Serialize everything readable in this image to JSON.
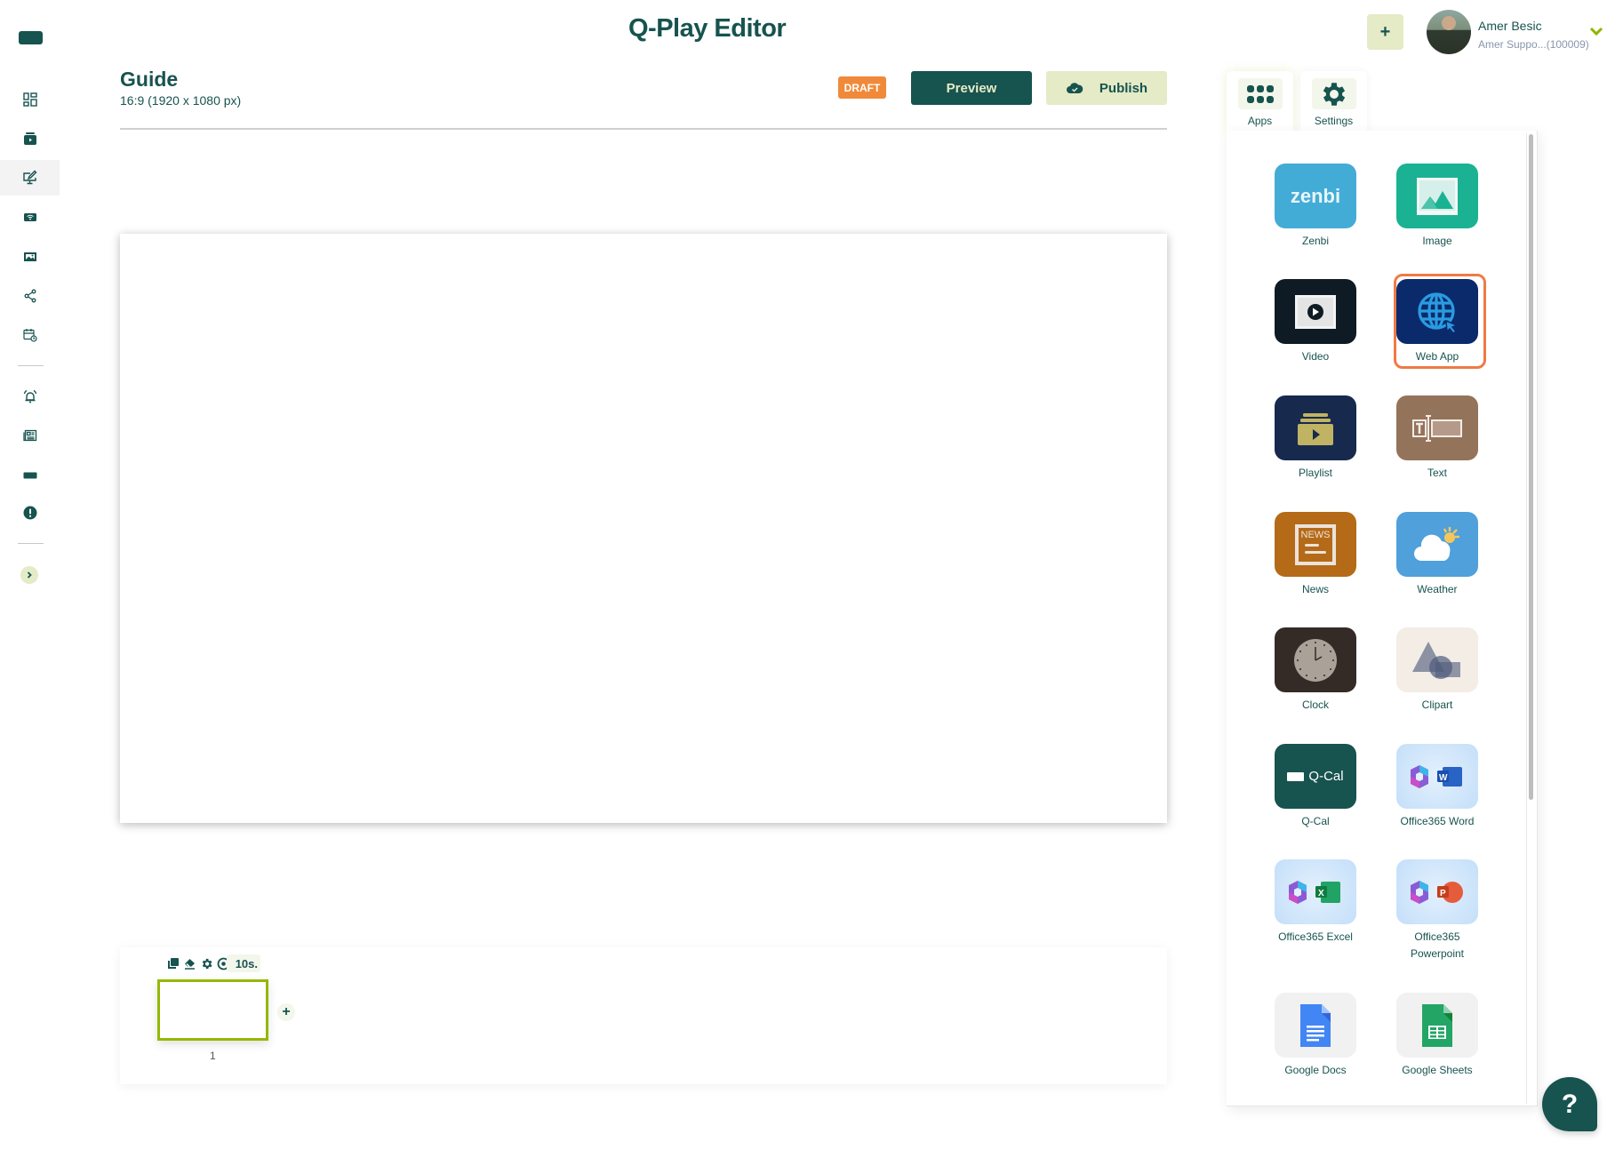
{
  "header": {
    "app_title": "Q-Play Editor",
    "add_button": "+",
    "user": {
      "name": "Amer Besic",
      "account": "Amer Suppo...(100009)",
      "menu_icon": "chevron-down-icon"
    }
  },
  "sidebar": {
    "logo": "q-play-logo",
    "items": [
      {
        "id": "dashboard",
        "icon": "dashboard-icon",
        "active": false
      },
      {
        "id": "media",
        "icon": "media-library-icon",
        "active": false
      },
      {
        "id": "editor",
        "icon": "editor-monitor-icon",
        "active": true
      },
      {
        "id": "players",
        "icon": "wifi-player-icon",
        "active": false
      },
      {
        "id": "gallery",
        "icon": "image-gallery-icon",
        "active": false
      },
      {
        "id": "share",
        "icon": "share-icon",
        "active": false
      },
      {
        "id": "schedule",
        "icon": "calendar-clock-icon",
        "active": false
      },
      {
        "id": "alerts",
        "icon": "alarm-bell-icon",
        "active": false
      },
      {
        "id": "news",
        "icon": "newspaper-icon",
        "active": false
      },
      {
        "id": "display",
        "icon": "screen-icon",
        "active": false
      },
      {
        "id": "info",
        "icon": "alert-circle-icon",
        "active": false
      }
    ],
    "expand_icon": "chevron-right-icon"
  },
  "page": {
    "title": "Guide",
    "subtitle": "16:9 (1920 x 1080 px)",
    "status_badge": "DRAFT",
    "preview_label": "Preview",
    "publish_label": "Publish"
  },
  "timeline": {
    "slides": [
      {
        "number": "1",
        "duration": "10s.",
        "selected": true
      }
    ],
    "tools": [
      "duplicate-icon",
      "erase-icon",
      "settings-icon",
      "visibility-icon"
    ],
    "add_slide": "+"
  },
  "panel": {
    "tabs": [
      {
        "label": "Apps",
        "icon": "apps-grid-icon",
        "active": true
      },
      {
        "label": "Settings",
        "icon": "gear-icon",
        "active": false
      }
    ],
    "apps": [
      {
        "label": "Zenbi",
        "tile_text": "zenbi",
        "color": "#43acd6"
      },
      {
        "label": "Image",
        "color": "#1ab293"
      },
      {
        "label": "Video",
        "color": "#0f1b24"
      },
      {
        "label": "Web App",
        "color": "#0a2a6b",
        "selected": true
      },
      {
        "label": "Playlist",
        "color": "#17294d"
      },
      {
        "label": "Text",
        "color": "#94735b"
      },
      {
        "label": "News",
        "tile_text": "NEWS",
        "color": "#b56a17"
      },
      {
        "label": "Weather",
        "color": "#4fa0db"
      },
      {
        "label": "Clock",
        "color": "#342b27"
      },
      {
        "label": "Clipart",
        "color": "#f3ede6"
      },
      {
        "label": "Q-Cal",
        "tile_text": "Q-Cal",
        "color": "#17534f"
      },
      {
        "label": "Office365 Word",
        "color": "#cfe5fb"
      },
      {
        "label": "Office365 Excel",
        "color": "#cfe5fb"
      },
      {
        "label": "Office365 Powerpoint",
        "color": "#cfe5fb"
      },
      {
        "label": "Google Docs",
        "color": "#f1f1f1"
      },
      {
        "label": "Google Sheets",
        "color": "#f1f1f1"
      }
    ]
  },
  "help": {
    "label": "?"
  },
  "colors": {
    "brand": "#17534f",
    "accent_light": "#e4ebc6",
    "draft": "#f08a3a",
    "selection": "#95b800",
    "app_highlight": "#f07a45"
  }
}
